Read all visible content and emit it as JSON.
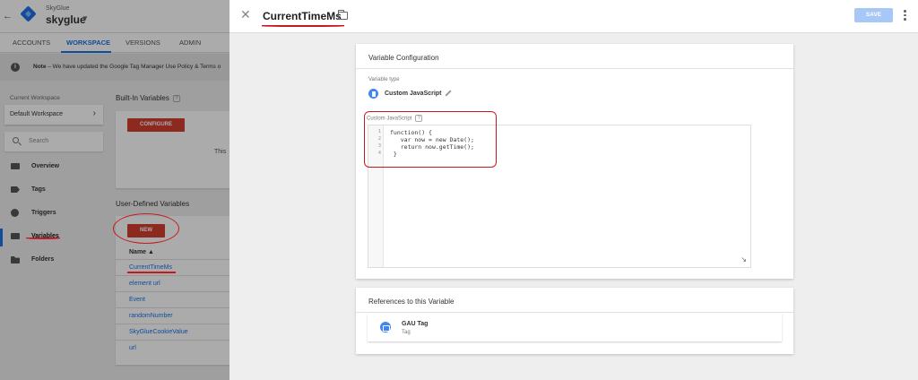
{
  "account": {
    "label": "SkyGlue",
    "container_name": "skyglue"
  },
  "top_tabs": [
    {
      "label": "ACCOUNTS"
    },
    {
      "label": "WORKSPACE"
    },
    {
      "label": "VERSIONS"
    },
    {
      "label": "ADMIN"
    }
  ],
  "notice": {
    "bold": "Note",
    "text": " – We have updated the Google Tag Manager Use Policy & Terms o"
  },
  "sidebar": {
    "current_workspace_label": "Current Workspace",
    "workspace_name": "Default Workspace",
    "search_placeholder": "Search",
    "items": [
      {
        "label": "Overview"
      },
      {
        "label": "Tags"
      },
      {
        "label": "Triggers"
      },
      {
        "label": "Variables"
      },
      {
        "label": "Folders"
      }
    ],
    "active_item": "Variables"
  },
  "builtin_variables": {
    "title": "Built-In Variables",
    "configure_label": "CONFIGURE",
    "body_fragment": "This"
  },
  "user_defined_variables": {
    "title": "User-Defined Variables",
    "new_label": "NEW",
    "column_name": "Name ▲",
    "rows": [
      {
        "name": "CurrentTimeMs"
      },
      {
        "name": "element url"
      },
      {
        "name": "Event"
      },
      {
        "name": "randomNumber"
      },
      {
        "name": "SkyGlueCookieValue"
      },
      {
        "name": "url"
      }
    ]
  },
  "editor": {
    "title": "CurrentTimeMs",
    "save_label": "SAVE",
    "config_card": {
      "title": "Variable Configuration",
      "variable_type_label": "Variable type",
      "variable_type": "Custom JavaScript",
      "code_label": "Custom JavaScript",
      "code_lines": [
        {
          "num": "1",
          "text": "function() {"
        },
        {
          "num": "2",
          "text": "   var now = new Date();"
        },
        {
          "num": "3",
          "text": "   return now.getTime();"
        },
        {
          "num": "4",
          "text": " }"
        }
      ]
    },
    "references_card": {
      "title": "References to this Variable",
      "items": [
        {
          "name": "GAU Tag",
          "type": "Tag"
        }
      ]
    }
  },
  "colors": {
    "accent": "#1a73e8",
    "save_button": "#a7c7f7",
    "new_button": "#d23f31",
    "annotation": "#c6191f"
  }
}
